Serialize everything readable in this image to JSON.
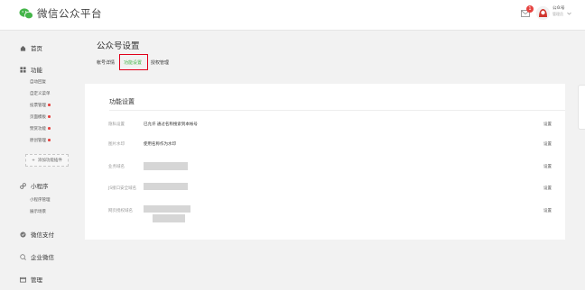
{
  "header": {
    "brand": "微信公众平台",
    "badge_count": "1",
    "user_name": "公众号",
    "user_role": "管理员"
  },
  "sidebar": {
    "groups": [
      {
        "label": "首页",
        "icon": "home-icon"
      },
      {
        "label": "功能",
        "icon": "grid-icon"
      },
      {
        "label": "小程序",
        "icon": "link-icon"
      },
      {
        "label": "微信支付",
        "icon": "wechat-pay-icon"
      },
      {
        "label": "企业微信",
        "icon": "search-circle-icon"
      },
      {
        "label": "管理",
        "icon": "folder-icon"
      }
    ],
    "function_items": [
      {
        "label": "自动回复",
        "dot": false
      },
      {
        "label": "自定义菜单",
        "dot": false
      },
      {
        "label": "投票管理",
        "dot": true
      },
      {
        "label": "页面模板",
        "dot": true
      },
      {
        "label": "赞赏功能",
        "dot": true
      },
      {
        "label": "原创管理",
        "dot": true
      }
    ],
    "add_plugin": "添加功能插件",
    "miniprogram_items": [
      {
        "label": "小程序管理"
      },
      {
        "label": "展示场景"
      }
    ]
  },
  "main": {
    "page_title": "公众号设置",
    "tabs": [
      {
        "label": "帐号详情",
        "active": false
      },
      {
        "label": "功能设置",
        "active": true
      },
      {
        "label": "授权管理",
        "active": false
      }
    ],
    "card_title": "功能设置",
    "rows": [
      {
        "label": "隐私设置",
        "value": "已允许 通过名称搜索到本帐号",
        "action": "设置"
      },
      {
        "label": "图片水印",
        "value": "使用名称作为水印",
        "action": "设置"
      },
      {
        "label": "业务域名",
        "value": "",
        "action": "设置"
      },
      {
        "label": "JS接口安全域名",
        "value": "",
        "action": "设置"
      },
      {
        "label": "网页授权域名",
        "value": "",
        "action": "设置"
      }
    ]
  },
  "colors": {
    "accent": "#44b549",
    "badge": "#e64340",
    "highlight": "#e0001a"
  }
}
